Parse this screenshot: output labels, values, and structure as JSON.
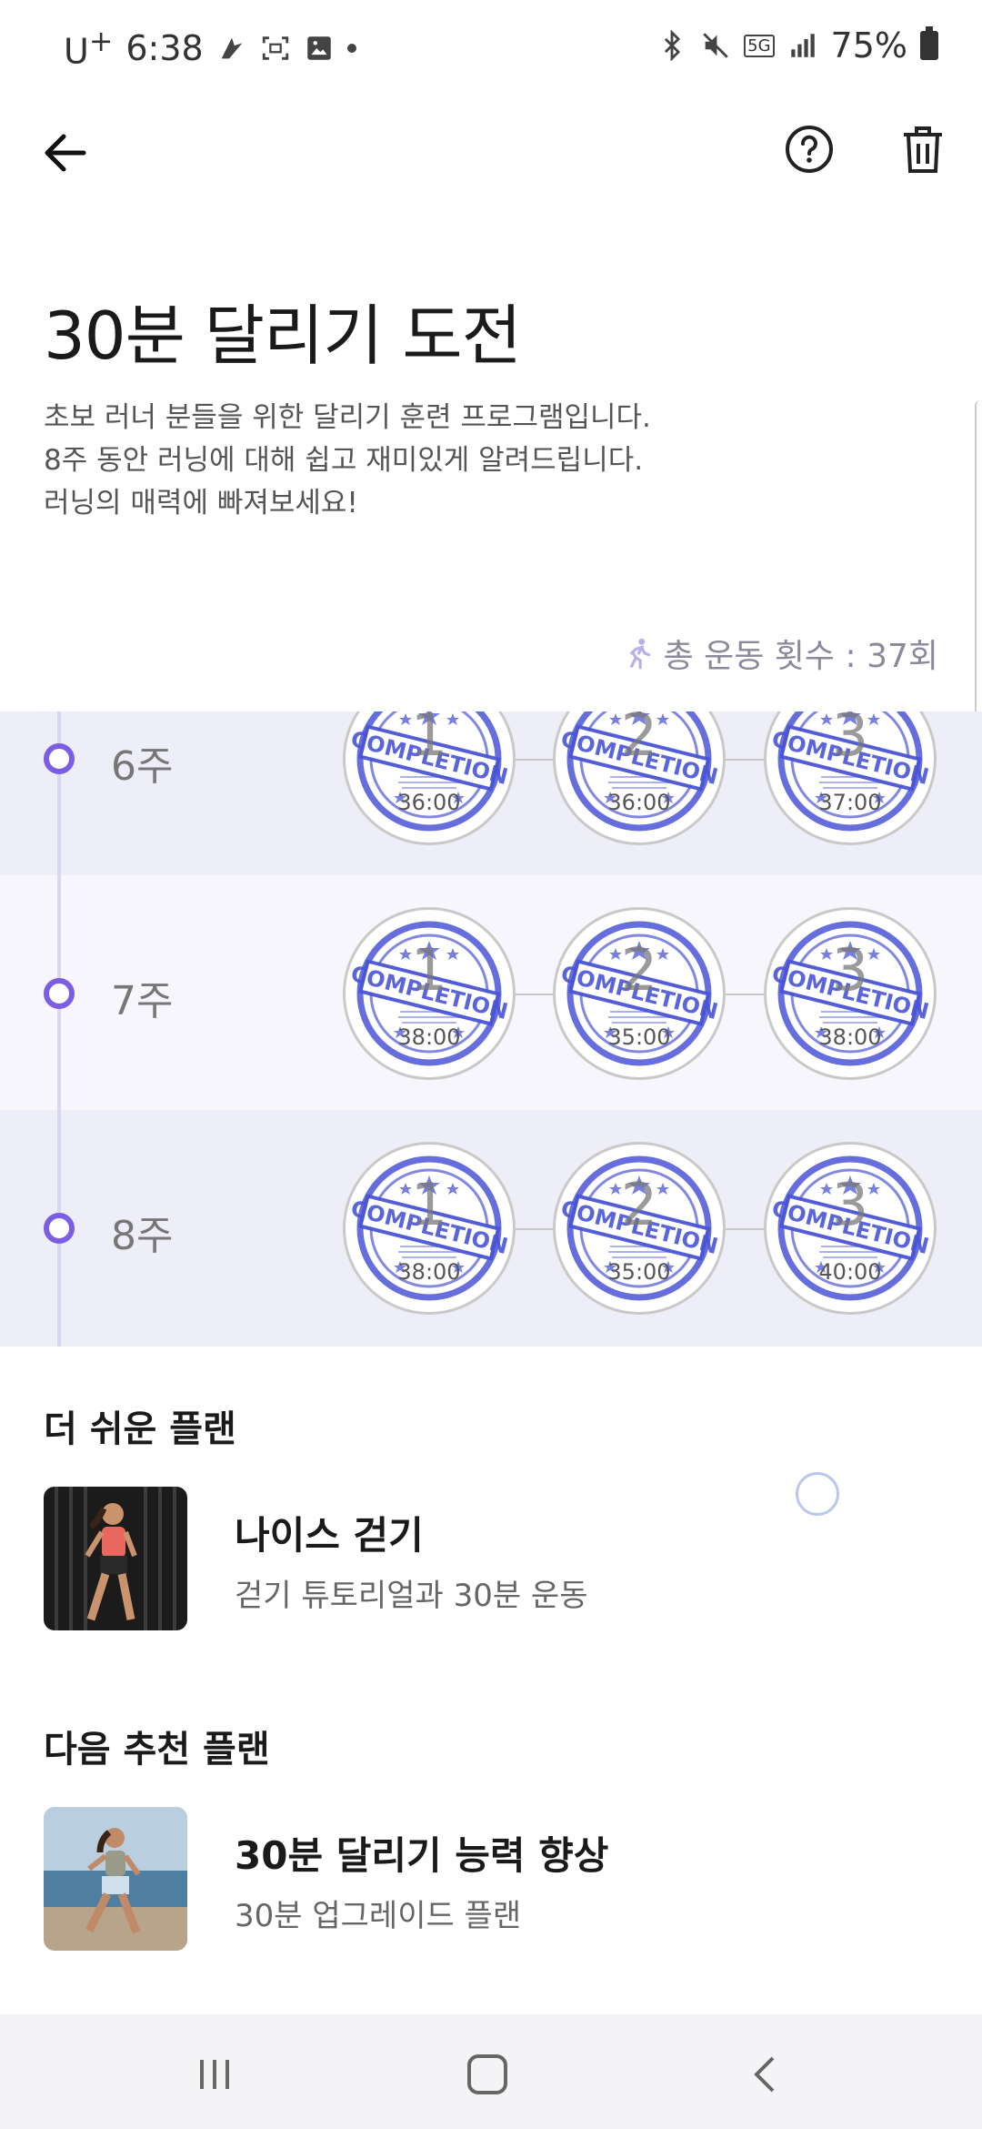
{
  "status_bar": {
    "carrier": "U",
    "carrier_sup": "+",
    "time": "6:38",
    "network": "5G",
    "battery": "75%"
  },
  "header": {
    "back_icon": "arrow-left-icon",
    "help_icon": "question-circle-icon",
    "delete_icon": "trash-icon"
  },
  "program": {
    "title": "30분 달리기 도전",
    "description": [
      "초보 러너 분들을 위한 달리기 훈련 프로그램입니다.",
      "8주 동안 러닝에 대해 쉽고 재미있게 알려드립니다.",
      "러닝의 매력에 빠져보세요!"
    ],
    "total_label": "총 운동 횟수 : 37회"
  },
  "weeks": [
    {
      "label": "6주",
      "sessions": [
        {
          "num": "1",
          "time": "36:00"
        },
        {
          "num": "2",
          "time": "36:00"
        },
        {
          "num": "3",
          "time": "37:00"
        }
      ]
    },
    {
      "label": "7주",
      "sessions": [
        {
          "num": "1",
          "time": "38:00"
        },
        {
          "num": "2",
          "time": "35:00"
        },
        {
          "num": "3",
          "time": "38:00"
        }
      ]
    },
    {
      "label": "8주",
      "sessions": [
        {
          "num": "1",
          "time": "38:00"
        },
        {
          "num": "2",
          "time": "35:00"
        },
        {
          "num": "3",
          "time": "40:00"
        }
      ]
    }
  ],
  "stamp_text": "COMPLETION",
  "easier_plan": {
    "section_title": "더 쉬운 플랜",
    "name": "나이스 걷기",
    "subtitle": "걷기 튜토리얼과 30분 운동"
  },
  "next_plan": {
    "section_title": "다음 추천 플랜",
    "name": "30분 달리기 능력 향상",
    "subtitle": "30분 업그레이드 플랜"
  },
  "colors": {
    "accent": "#7b5ee3",
    "stamp_blue": "#4a55d6",
    "row_bg": "#eeeef8"
  }
}
